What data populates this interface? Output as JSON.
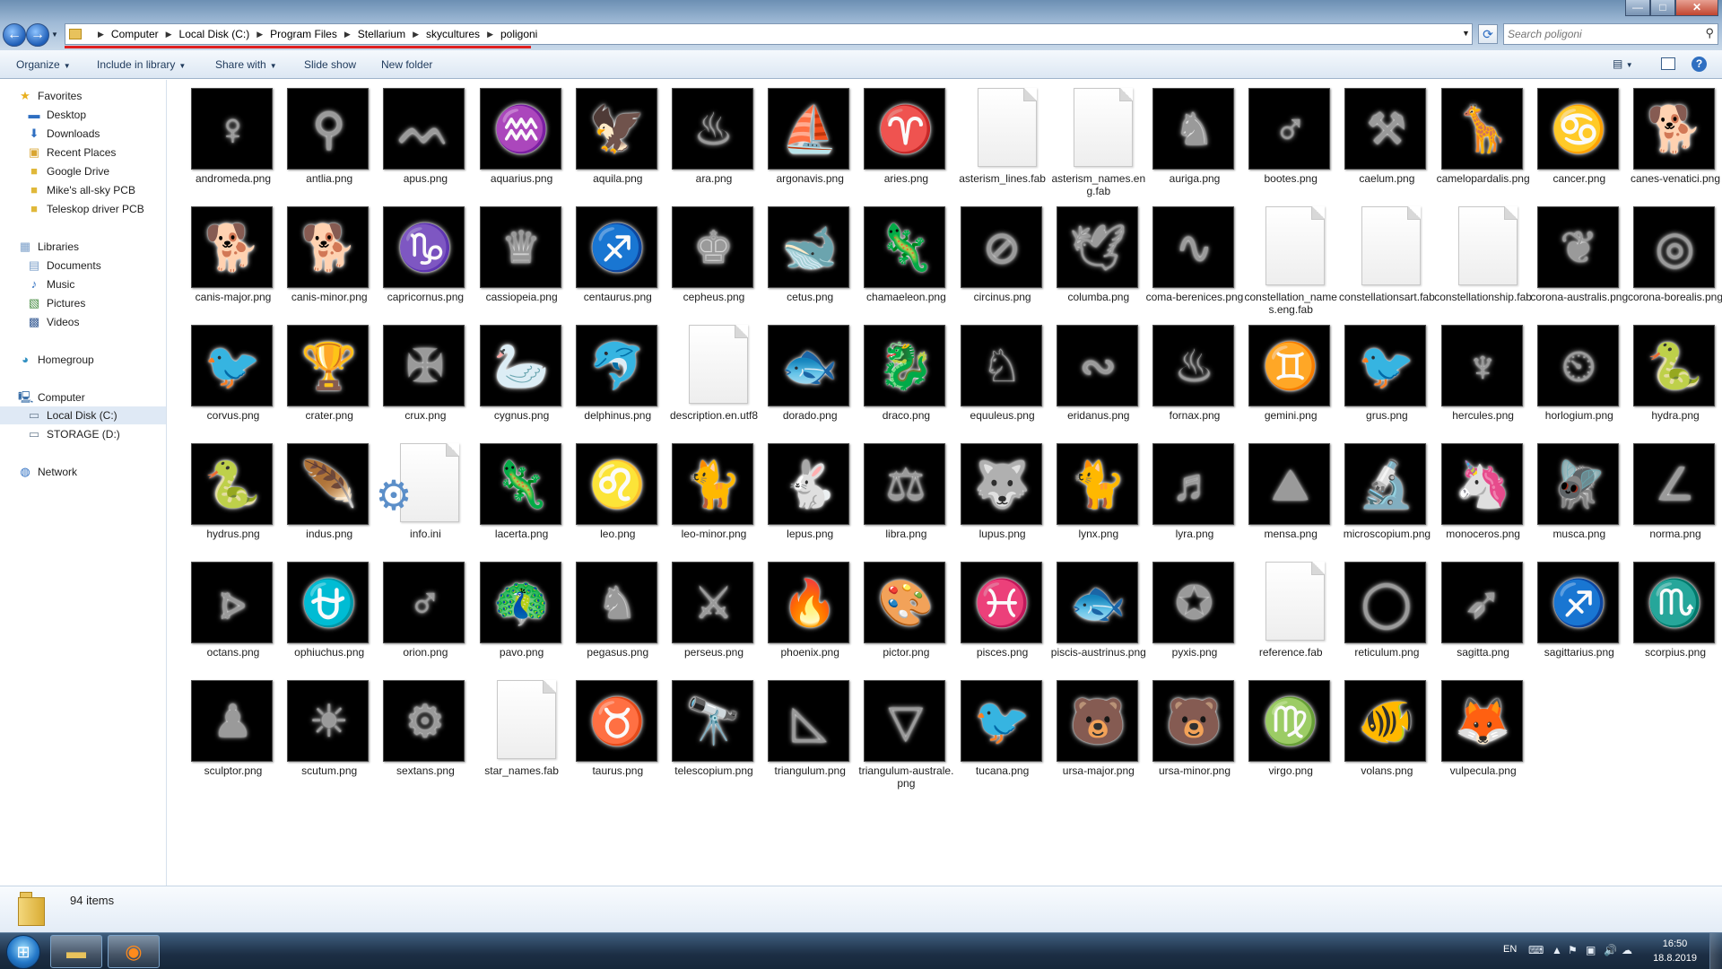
{
  "window": {
    "breadcrumb": [
      "Computer",
      "Local Disk (C:)",
      "Program Files",
      "Stellarium",
      "skycultures",
      "poligoni"
    ],
    "search_placeholder": "Search poligoni",
    "controls": {
      "minimize": "—",
      "maximize": "□",
      "close": "✕"
    }
  },
  "toolbar": {
    "organize": "Organize",
    "include_in_library": "Include in library",
    "share_with": "Share with",
    "slide_show": "Slide show",
    "new_folder": "New folder"
  },
  "sidebar": {
    "favorites": "Favorites",
    "desktop": "Desktop",
    "downloads": "Downloads",
    "recent_places": "Recent Places",
    "google_drive": "Google Drive",
    "mikes_pcb": "Mike's all-sky PCB",
    "teleskop_pcb": "Teleskop driver PCB",
    "libraries": "Libraries",
    "documents": "Documents",
    "music": "Music",
    "pictures": "Pictures",
    "videos": "Videos",
    "homegroup": "Homegroup",
    "computer": "Computer",
    "local_disk": "Local Disk (C:)",
    "storage": "STORAGE (D:)",
    "network": "Network"
  },
  "files": [
    {
      "name": "andromeda.png",
      "kind": "image",
      "glyph": "♀"
    },
    {
      "name": "antlia.png",
      "kind": "image",
      "glyph": "⚲"
    },
    {
      "name": "apus.png",
      "kind": "image",
      "glyph": "ᨓ"
    },
    {
      "name": "aquarius.png",
      "kind": "image",
      "glyph": "♒"
    },
    {
      "name": "aquila.png",
      "kind": "image",
      "glyph": "🦅"
    },
    {
      "name": "ara.png",
      "kind": "image",
      "glyph": "♨"
    },
    {
      "name": "argonavis.png",
      "kind": "image",
      "glyph": "⛵"
    },
    {
      "name": "aries.png",
      "kind": "image",
      "glyph": "♈"
    },
    {
      "name": "asterism_lines.fab",
      "kind": "doc"
    },
    {
      "name": "asterism_names.eng.fab",
      "kind": "doc"
    },
    {
      "name": "auriga.png",
      "kind": "image",
      "glyph": "♞"
    },
    {
      "name": "bootes.png",
      "kind": "image",
      "glyph": "♂"
    },
    {
      "name": "caelum.png",
      "kind": "image",
      "glyph": "⚒"
    },
    {
      "name": "camelopardalis.png",
      "kind": "image",
      "glyph": "🦒"
    },
    {
      "name": "cancer.png",
      "kind": "image",
      "glyph": "♋"
    },
    {
      "name": "canes-venatici.png",
      "kind": "image",
      "glyph": "🐕"
    },
    {
      "name": "canis-major.png",
      "kind": "image",
      "glyph": "🐕"
    },
    {
      "name": "canis-minor.png",
      "kind": "image",
      "glyph": "🐕"
    },
    {
      "name": "capricornus.png",
      "kind": "image",
      "glyph": "♑"
    },
    {
      "name": "cassiopeia.png",
      "kind": "image",
      "glyph": "♛"
    },
    {
      "name": "centaurus.png",
      "kind": "image",
      "glyph": "♐"
    },
    {
      "name": "cepheus.png",
      "kind": "image",
      "glyph": "♚"
    },
    {
      "name": "cetus.png",
      "kind": "image",
      "glyph": "🐋"
    },
    {
      "name": "chamaeleon.png",
      "kind": "image",
      "glyph": "🦎"
    },
    {
      "name": "circinus.png",
      "kind": "image",
      "glyph": "⊘"
    },
    {
      "name": "columba.png",
      "kind": "image",
      "glyph": "🕊"
    },
    {
      "name": "coma-berenices.png",
      "kind": "image",
      "glyph": "∿"
    },
    {
      "name": "constellation_names.eng.fab",
      "kind": "doc"
    },
    {
      "name": "constellationsart.fab",
      "kind": "doc"
    },
    {
      "name": "constellationship.fab",
      "kind": "doc"
    },
    {
      "name": "corona-australis.png",
      "kind": "image",
      "glyph": "❦"
    },
    {
      "name": "corona-borealis.png",
      "kind": "image",
      "glyph": "◎"
    },
    {
      "name": "corvus.png",
      "kind": "image",
      "glyph": "🐦"
    },
    {
      "name": "crater.png",
      "kind": "image",
      "glyph": "🏆"
    },
    {
      "name": "crux.png",
      "kind": "image",
      "glyph": "✠"
    },
    {
      "name": "cygnus.png",
      "kind": "image",
      "glyph": "🦢"
    },
    {
      "name": "delphinus.png",
      "kind": "image",
      "glyph": "🐬"
    },
    {
      "name": "description.en.utf8",
      "kind": "doc"
    },
    {
      "name": "dorado.png",
      "kind": "image",
      "glyph": "🐟"
    },
    {
      "name": "draco.png",
      "kind": "image",
      "glyph": "🐉"
    },
    {
      "name": "equuleus.png",
      "kind": "image",
      "glyph": "♘"
    },
    {
      "name": "eridanus.png",
      "kind": "image",
      "glyph": "∾"
    },
    {
      "name": "fornax.png",
      "kind": "image",
      "glyph": "♨"
    },
    {
      "name": "gemini.png",
      "kind": "image",
      "glyph": "♊"
    },
    {
      "name": "grus.png",
      "kind": "image",
      "glyph": "🐦"
    },
    {
      "name": "hercules.png",
      "kind": "image",
      "glyph": "♆"
    },
    {
      "name": "horlogium.png",
      "kind": "image",
      "glyph": "⏲"
    },
    {
      "name": "hydra.png",
      "kind": "image",
      "glyph": "🐍"
    },
    {
      "name": "hydrus.png",
      "kind": "image",
      "glyph": "🐍"
    },
    {
      "name": "indus.png",
      "kind": "image",
      "glyph": "🪶"
    },
    {
      "name": "info.ini",
      "kind": "ini"
    },
    {
      "name": "lacerta.png",
      "kind": "image",
      "glyph": "🦎"
    },
    {
      "name": "leo.png",
      "kind": "image",
      "glyph": "♌"
    },
    {
      "name": "leo-minor.png",
      "kind": "image",
      "glyph": "🐈"
    },
    {
      "name": "lepus.png",
      "kind": "image",
      "glyph": "🐇"
    },
    {
      "name": "libra.png",
      "kind": "image",
      "glyph": "⚖"
    },
    {
      "name": "lupus.png",
      "kind": "image",
      "glyph": "🐺"
    },
    {
      "name": "lynx.png",
      "kind": "image",
      "glyph": "🐈"
    },
    {
      "name": "lyra.png",
      "kind": "image",
      "glyph": "♬"
    },
    {
      "name": "mensa.png",
      "kind": "image",
      "glyph": "⛰"
    },
    {
      "name": "microscopium.png",
      "kind": "image",
      "glyph": "🔬"
    },
    {
      "name": "monoceros.png",
      "kind": "image",
      "glyph": "🦄"
    },
    {
      "name": "musca.png",
      "kind": "image",
      "glyph": "🪰"
    },
    {
      "name": "norma.png",
      "kind": "image",
      "glyph": "∠"
    },
    {
      "name": "octans.png",
      "kind": "image",
      "glyph": "⦠"
    },
    {
      "name": "ophiuchus.png",
      "kind": "image",
      "glyph": "⛎"
    },
    {
      "name": "orion.png",
      "kind": "image",
      "glyph": "♂"
    },
    {
      "name": "pavo.png",
      "kind": "image",
      "glyph": "🦚"
    },
    {
      "name": "pegasus.png",
      "kind": "image",
      "glyph": "♞"
    },
    {
      "name": "perseus.png",
      "kind": "image",
      "glyph": "⚔"
    },
    {
      "name": "phoenix.png",
      "kind": "image",
      "glyph": "🔥"
    },
    {
      "name": "pictor.png",
      "kind": "image",
      "glyph": "🎨"
    },
    {
      "name": "pisces.png",
      "kind": "image",
      "glyph": "♓"
    },
    {
      "name": "piscis-austrinus.png",
      "kind": "image",
      "glyph": "🐟"
    },
    {
      "name": "pyxis.png",
      "kind": "image",
      "glyph": "✪"
    },
    {
      "name": "reference.fab",
      "kind": "doc"
    },
    {
      "name": "reticulum.png",
      "kind": "image",
      "glyph": "◯"
    },
    {
      "name": "sagitta.png",
      "kind": "image",
      "glyph": "➶"
    },
    {
      "name": "sagittarius.png",
      "kind": "image",
      "glyph": "♐"
    },
    {
      "name": "scorpius.png",
      "kind": "image",
      "glyph": "♏"
    },
    {
      "name": "sculptor.png",
      "kind": "image",
      "glyph": "♟"
    },
    {
      "name": "scutum.png",
      "kind": "image",
      "glyph": "☀"
    },
    {
      "name": "sextans.png",
      "kind": "image",
      "glyph": "⚙"
    },
    {
      "name": "star_names.fab",
      "kind": "doc"
    },
    {
      "name": "taurus.png",
      "kind": "image",
      "glyph": "♉"
    },
    {
      "name": "telescopium.png",
      "kind": "image",
      "glyph": "🔭"
    },
    {
      "name": "triangulum.png",
      "kind": "image",
      "glyph": "◺"
    },
    {
      "name": "triangulum-australe.png",
      "kind": "image",
      "glyph": "▽"
    },
    {
      "name": "tucana.png",
      "kind": "image",
      "glyph": "🐦"
    },
    {
      "name": "ursa-major.png",
      "kind": "image",
      "glyph": "🐻"
    },
    {
      "name": "ursa-minor.png",
      "kind": "image",
      "glyph": "🐻"
    },
    {
      "name": "virgo.png",
      "kind": "image",
      "glyph": "♍"
    },
    {
      "name": "volans.png",
      "kind": "image",
      "glyph": "🐠"
    },
    {
      "name": "vulpecula.png",
      "kind": "image",
      "glyph": "🦊"
    }
  ],
  "status": {
    "item_count": "94 items"
  },
  "taskbar": {
    "language": "EN",
    "time": "16:50",
    "date": "18.8.2019"
  },
  "colors": {
    "address_underline": "#e02020",
    "thumb_bg": "#000000",
    "selection": "#dfe9f5"
  }
}
